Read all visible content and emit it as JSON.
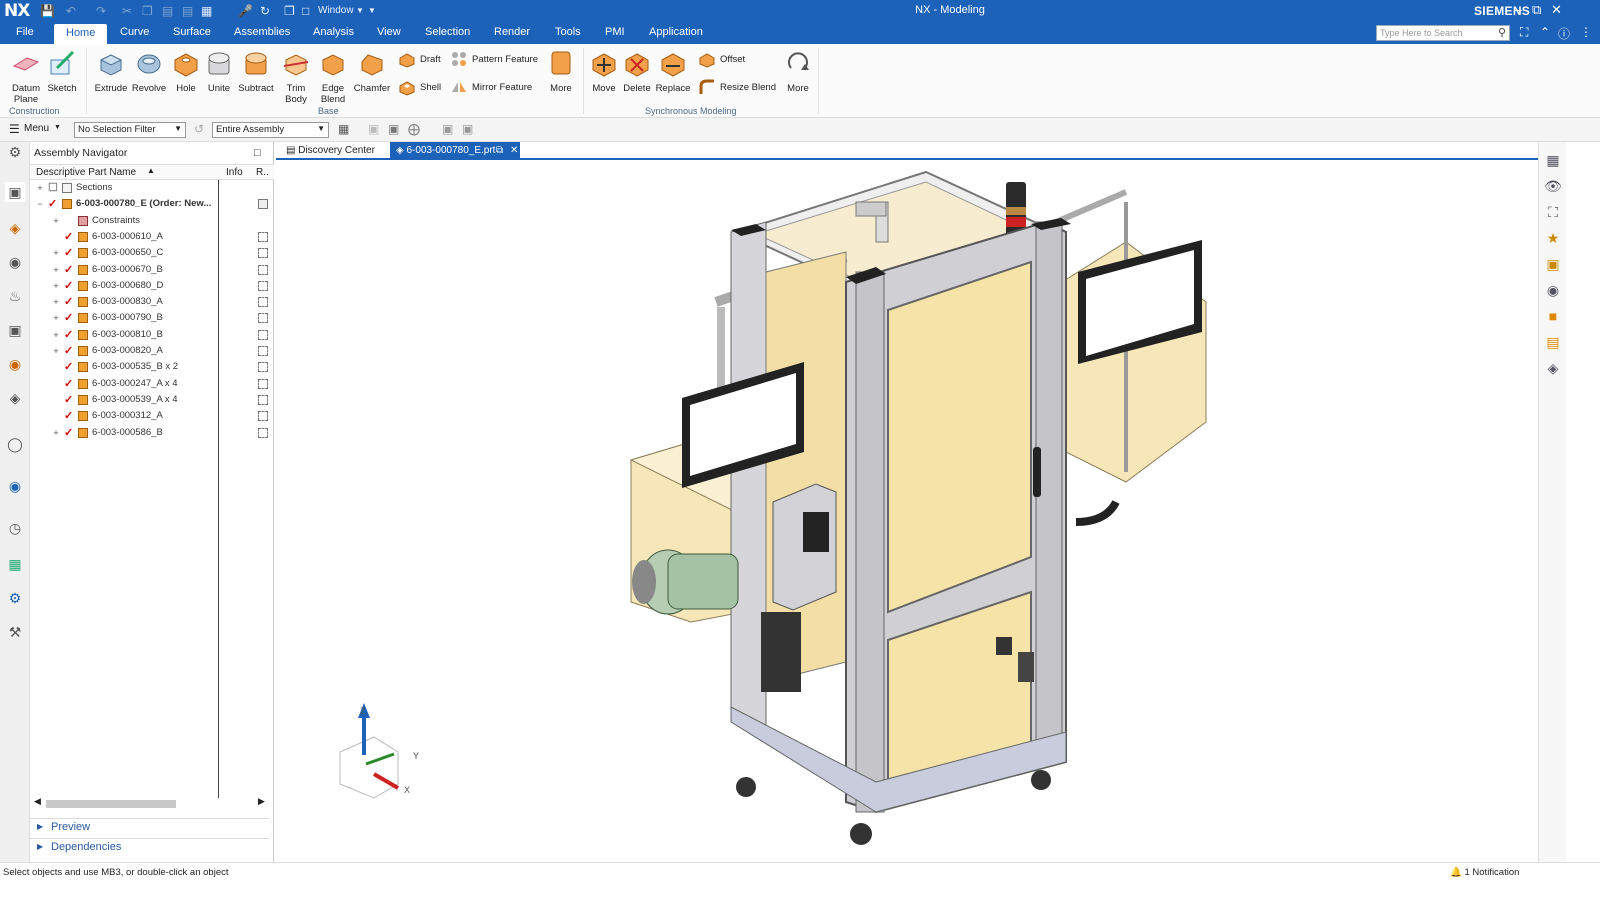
{
  "titlebar": {
    "logo": "NX",
    "window_menu": "Window",
    "title": "NX - Modeling",
    "brand": "SIEMENS"
  },
  "menu_tabs": [
    "File",
    "Home",
    "Curve",
    "Surface",
    "Assemblies",
    "Analysis",
    "View",
    "Selection",
    "Render",
    "Tools",
    "PMI",
    "Application"
  ],
  "active_tab": "Home",
  "search": {
    "placeholder": "Type Here to Search"
  },
  "ribbon": {
    "datum_plane": "Datum Plane",
    "sketch": "Sketch",
    "extrude": "Extrude",
    "revolve": "Revolve",
    "hole": "Hole",
    "unite": "Unite",
    "subtract": "Subtract",
    "trim_body": "Trim Body",
    "edge_blend": "Edge Blend",
    "chamfer": "Chamfer",
    "draft": "Draft",
    "shell": "Shell",
    "pattern_feature": "Pattern Feature",
    "mirror_feature": "Mirror Feature",
    "more1": "More",
    "move": "Move",
    "delete": "Delete",
    "replace": "Replace",
    "offset": "Offset",
    "resize_blend": "Resize Blend",
    "more2": "More",
    "group_construction": "Construction",
    "group_base": "Base",
    "group_sync": "Synchronous Modeling"
  },
  "selection_bar": {
    "menu": "Menu",
    "filter": "No Selection Filter",
    "scope": "Entire Assembly"
  },
  "navigator": {
    "title": "Assembly Navigator",
    "col_name": "Descriptive Part Name",
    "col_info": "Info",
    "col_r": "R..",
    "rows": [
      {
        "label": "Sections",
        "expand": "+"
      },
      {
        "label": "6-003-000780_E (Order: New...",
        "expand": "−"
      },
      {
        "label": "Constraints",
        "expand": "+"
      },
      {
        "label": "6-003-000610_A",
        "expand": ""
      },
      {
        "label": "6-003-000650_C",
        "expand": "+"
      },
      {
        "label": "6-003-000670_B",
        "expand": "+"
      },
      {
        "label": "6-003-000680_D",
        "expand": "+"
      },
      {
        "label": "6-003-000830_A",
        "expand": "+"
      },
      {
        "label": "6-003-000790_B",
        "expand": "+"
      },
      {
        "label": "6-003-000810_B",
        "expand": "+"
      },
      {
        "label": "6-003-000820_A",
        "expand": "+"
      },
      {
        "label": "6-003-000535_B x 2",
        "expand": ""
      },
      {
        "label": "6-003-000247_A x 4",
        "expand": ""
      },
      {
        "label": "6-003-000539_A x 4",
        "expand": ""
      },
      {
        "label": "6-003-000312_A",
        "expand": ""
      },
      {
        "label": "6-003-000586_B",
        "expand": "+"
      }
    ],
    "preview": "Preview",
    "dependencies": "Dependencies"
  },
  "doc_tabs": {
    "discovery": "Discovery Center",
    "part": "6-003-000780_E.prt"
  },
  "triad": {
    "z": "Z",
    "y": "Y",
    "x": "X"
  },
  "status": {
    "message": "Select objects and use MB3, or double-click an object",
    "notification": "1 Notification"
  },
  "colors": {
    "accent": "#1c62b8",
    "panel": "#f6e3a8",
    "frame": "#c8c8cc"
  }
}
